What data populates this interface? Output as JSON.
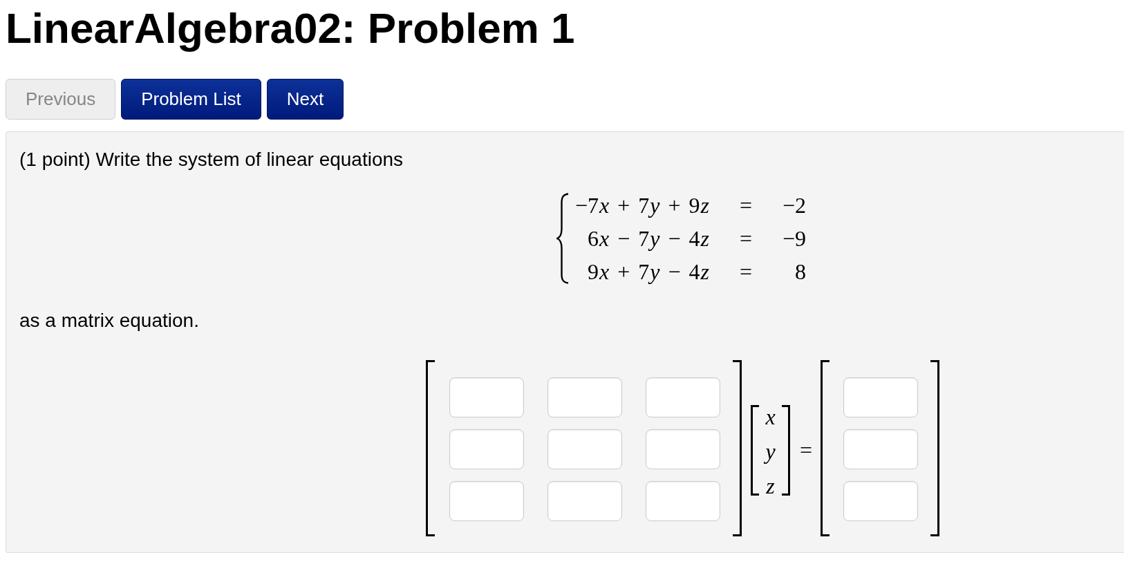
{
  "page": {
    "title": "LinearAlgebra02: Problem 1"
  },
  "nav_buttons": [
    {
      "label": "Previous",
      "disabled": true
    },
    {
      "label": "Problem List",
      "disabled": false
    },
    {
      "label": "Next",
      "disabled": false
    }
  ],
  "problem": {
    "prompt": "(1 point) Write the system of linear equations",
    "system": [
      {
        "lhs": [
          {
            "kind": "number",
            "text": "−7"
          },
          {
            "kind": "variable",
            "text": "x"
          },
          {
            "kind": "operator",
            "text": "+"
          },
          {
            "kind": "number",
            "text": "7"
          },
          {
            "kind": "variable",
            "text": "y"
          },
          {
            "kind": "operator",
            "text": "+"
          },
          {
            "kind": "number",
            "text": "9"
          },
          {
            "kind": "variable",
            "text": "z"
          }
        ],
        "relation": "=",
        "rhs": "−2"
      },
      {
        "lhs": [
          {
            "kind": "number",
            "text": "6"
          },
          {
            "kind": "variable",
            "text": "x"
          },
          {
            "kind": "operator",
            "text": "−"
          },
          {
            "kind": "number",
            "text": "7"
          },
          {
            "kind": "variable",
            "text": "y"
          },
          {
            "kind": "operator",
            "text": "−"
          },
          {
            "kind": "number",
            "text": "4"
          },
          {
            "kind": "variable",
            "text": "z"
          }
        ],
        "relation": "=",
        "rhs": "−9"
      },
      {
        "lhs": [
          {
            "kind": "number",
            "text": "9"
          },
          {
            "kind": "variable",
            "text": "x"
          },
          {
            "kind": "operator",
            "text": "+"
          },
          {
            "kind": "number",
            "text": "7"
          },
          {
            "kind": "variable",
            "text": "y"
          },
          {
            "kind": "operator",
            "text": "−"
          },
          {
            "kind": "number",
            "text": "4"
          },
          {
            "kind": "variable",
            "text": "z"
          }
        ],
        "relation": "=",
        "rhs": "8"
      }
    ],
    "instruction": "as a matrix equation.",
    "matrix_equation": {
      "coefficients": [
        [
          {
            "kind": "answer_box"
          },
          {
            "kind": "answer_box"
          },
          {
            "kind": "answer_box"
          }
        ],
        [
          {
            "kind": "answer_box"
          },
          {
            "kind": "answer_box"
          },
          {
            "kind": "answer_box"
          }
        ],
        [
          {
            "kind": "answer_box"
          },
          {
            "kind": "answer_box"
          },
          {
            "kind": "answer_box"
          }
        ]
      ],
      "variables": [
        "x",
        "y",
        "z"
      ],
      "relation": "=",
      "constants": [
        [
          {
            "kind": "answer_box"
          }
        ],
        [
          {
            "kind": "answer_box"
          }
        ],
        [
          {
            "kind": "answer_box"
          }
        ]
      ]
    }
  }
}
